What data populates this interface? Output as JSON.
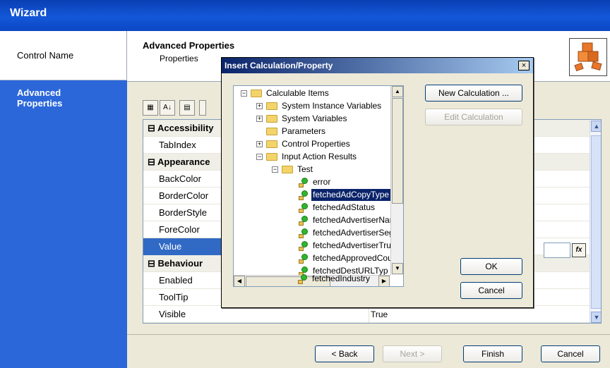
{
  "window": {
    "title": "Wizard"
  },
  "nav": {
    "items": [
      {
        "label": "Control Name"
      },
      {
        "label": "Advanced Properties"
      }
    ]
  },
  "header": {
    "title": "Advanced Properties",
    "subtitle": "Properties"
  },
  "toolbar": {
    "icons": [
      "categorized-icon",
      "alphabetical-sort-icon",
      "property-pages-icon"
    ],
    "sort_glyph": "A↓"
  },
  "grid": {
    "rows": [
      {
        "type": "category",
        "name": "Accessibility",
        "toggle": "⊟"
      },
      {
        "type": "prop",
        "name": "TabIndex",
        "value": ""
      },
      {
        "type": "category",
        "name": "Appearance",
        "toggle": "⊟"
      },
      {
        "type": "prop",
        "name": "BackColor",
        "value": ""
      },
      {
        "type": "prop",
        "name": "BorderColor",
        "value": ""
      },
      {
        "type": "prop",
        "name": "BorderStyle",
        "value": ""
      },
      {
        "type": "prop",
        "name": "ForeColor",
        "value": ""
      },
      {
        "type": "prop",
        "name": "Value",
        "value": "",
        "selected": true
      },
      {
        "type": "category",
        "name": "Behaviour",
        "toggle": "⊟"
      },
      {
        "type": "prop",
        "name": "Enabled",
        "value": ""
      },
      {
        "type": "prop",
        "name": "ToolTip",
        "value": ""
      },
      {
        "type": "prop",
        "name": "Visible",
        "value": "True"
      }
    ],
    "fx_label": "fx"
  },
  "footer": {
    "back": "< Back",
    "next": "Next >",
    "finish": "Finish",
    "cancel": "Cancel"
  },
  "dialog": {
    "title": "Insert Calculation/Property",
    "close": "×",
    "new_calc": "New Calculation ...",
    "edit_calc": "Edit Calculation",
    "ok": "OK",
    "cancel": "Cancel",
    "tree": [
      {
        "label": "Calculable Items",
        "toggle": "−",
        "icon": "folder-open"
      },
      {
        "label": "System Instance Variables",
        "toggle": "+",
        "icon": "folder"
      },
      {
        "label": "System Variables",
        "toggle": "+",
        "icon": "folder"
      },
      {
        "label": "Parameters",
        "toggle": "",
        "icon": "folder"
      },
      {
        "label": "Control Properties",
        "toggle": "+",
        "icon": "folder"
      },
      {
        "label": "Input Action Results",
        "toggle": "−",
        "icon": "folder-open"
      },
      {
        "label": "Test",
        "toggle": "−",
        "icon": "folder-open"
      },
      {
        "label": "error",
        "icon": "leaf"
      },
      {
        "label": "fetchedAdCopyType",
        "icon": "leaf",
        "selected": true
      },
      {
        "label": "fetchedAdStatus",
        "icon": "leaf"
      },
      {
        "label": "fetchedAdvertiserNar",
        "icon": "leaf"
      },
      {
        "label": "fetchedAdvertiserSeg",
        "icon": "leaf"
      },
      {
        "label": "fetchedAdvertiserTru",
        "icon": "leaf"
      },
      {
        "label": "fetchedApprovedCou",
        "icon": "leaf"
      },
      {
        "label": "fetchedDestURLTyp",
        "icon": "leaf"
      },
      {
        "label": "fetchedIndustry",
        "icon": "leaf"
      }
    ]
  }
}
